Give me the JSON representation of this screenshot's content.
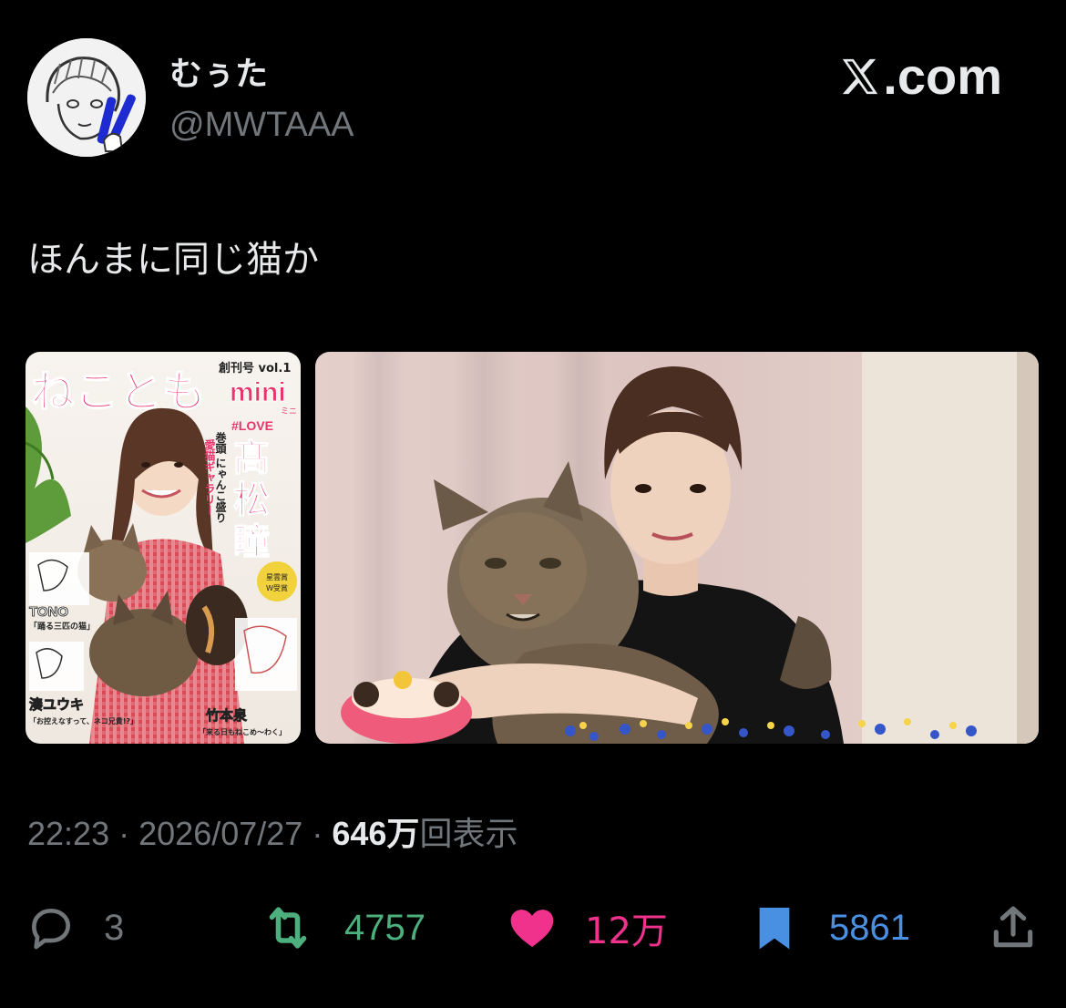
{
  "author": {
    "display_name": "むぅた",
    "handle": "@MWTAAA",
    "avatar_icon": "sketch-avatar-icon"
  },
  "brand": {
    "label": ".com",
    "icon": "x-logo-icon"
  },
  "tweet": {
    "text": "ほんまに同じ猫か"
  },
  "media": {
    "left": {
      "kind": "magazine-cover",
      "logo": "ねことも",
      "issue": "創刊号 vol.1",
      "mini": "mini",
      "mini_kana": "ミニ",
      "love_tag": "#LOVE",
      "cover_name": "髙松瞳",
      "headline": "巻頭 にゃんこ盛り",
      "gallery": "愛猫ギャラリー",
      "artist_1": "TONO",
      "artist_1_title": "「踊る三匹の猫」",
      "artist_2": "湊ユウキ",
      "artist_2_title": "「お控えなすって、ネコ兄貴!?」",
      "artist_3": "竹本泉",
      "artist_3_title": "「来る日もねこめ～わく」",
      "award": "星雲賞 W受賞"
    },
    "right": {
      "kind": "livestream-photo"
    }
  },
  "meta": {
    "time": "22:23",
    "separator": "·",
    "date": "2026/07/27",
    "views_count": "646",
    "views_unit": "万",
    "views_label": "回表示"
  },
  "actions": {
    "reply_count": "3",
    "retweet_count": "4757",
    "like_count": "12万",
    "bookmark_count": "5861"
  },
  "colors": {
    "background": "#000000",
    "text": "#e7e9ea",
    "muted": "#71767b",
    "retweet": "#4caf7d",
    "like": "#f0328c",
    "bookmark": "#4a90e2"
  }
}
